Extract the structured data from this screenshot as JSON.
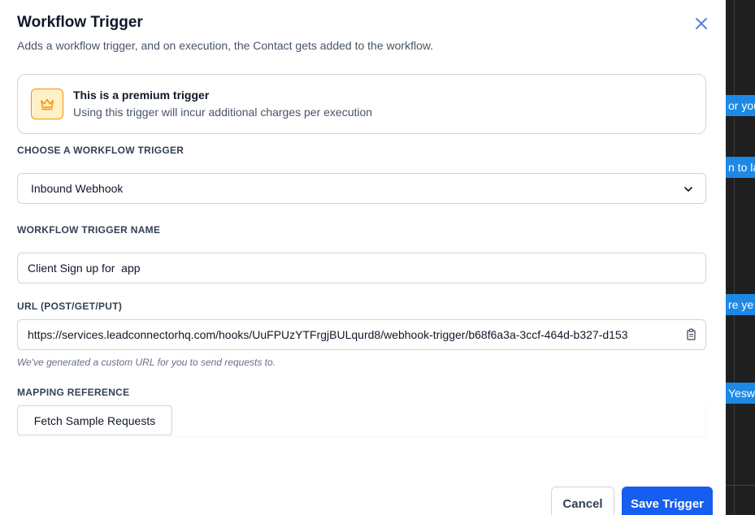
{
  "background": {
    "snippets": [
      "or you",
      "n to la",
      "re  ye",
      "Yesw"
    ],
    "accent": "#1e88e5"
  },
  "modal": {
    "title": "Workflow Trigger",
    "subtitle": "Adds a workflow trigger, and on execution, the Contact gets added to the workflow.",
    "close_icon": "close-icon"
  },
  "premium": {
    "icon": "crown-icon",
    "title": "This is a premium trigger",
    "description": "Using this trigger will incur additional charges per execution"
  },
  "trigger_select": {
    "label": "CHOOSE A WORKFLOW TRIGGER",
    "selected": "Inbound Webhook",
    "icon": "chevron-down-icon"
  },
  "trigger_name": {
    "label": "WORKFLOW TRIGGER NAME",
    "value": "Client Sign up for  app"
  },
  "url": {
    "label": "URL (POST/GET/PUT)",
    "value": "https://services.leadconnectorhq.com/hooks/UuFPUzYTFrgjBULqurd8/webhook-trigger/b68f6a3a-3ccf-464d-b327-d153",
    "hint": "We've generated a custom URL for you to send requests to.",
    "copy_icon": "copy-icon"
  },
  "mapping": {
    "label": "MAPPING REFERENCE",
    "fetch_button": "Fetch Sample Requests"
  },
  "footer": {
    "cancel": "Cancel",
    "save": "Save Trigger",
    "primary_color": "#155eef"
  }
}
